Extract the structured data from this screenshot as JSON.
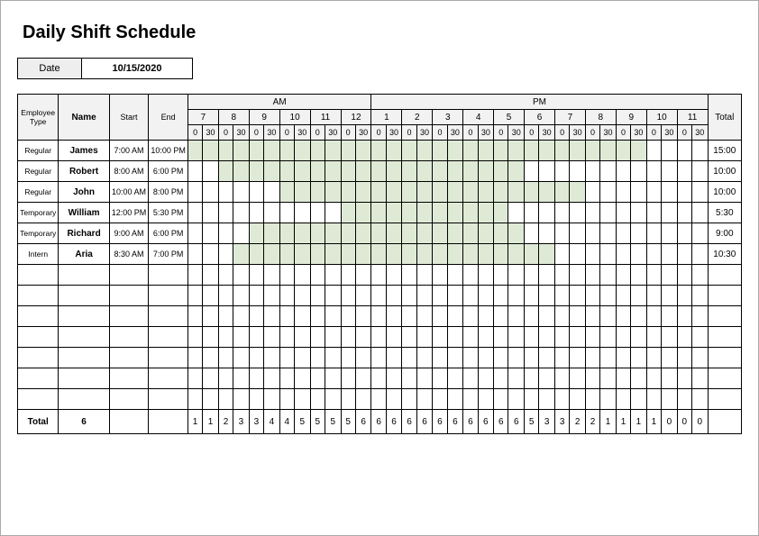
{
  "title": "Daily Shift Schedule",
  "date_label": "Date",
  "date_value": "10/15/2020",
  "headers": {
    "employee_type": "Employee\nType",
    "name": "Name",
    "start": "Start",
    "end": "End",
    "am": "AM",
    "pm": "PM",
    "total": "Total",
    "hours": [
      "7",
      "8",
      "9",
      "10",
      "11",
      "12",
      "1",
      "2",
      "3",
      "4",
      "5",
      "6",
      "7",
      "8",
      "9",
      "10",
      "11"
    ],
    "halves": [
      "0",
      "30"
    ]
  },
  "slot_start_hour": 7,
  "slot_count": 34,
  "rows": [
    {
      "type": "Regular",
      "name": "James",
      "start": "7:00 AM",
      "end": "10:00 PM",
      "fill_from": 0,
      "fill_to": 30,
      "total": "15:00"
    },
    {
      "type": "Regular",
      "name": "Robert",
      "start": "8:00 AM",
      "end": "6:00 PM",
      "fill_from": 2,
      "fill_to": 22,
      "total": "10:00"
    },
    {
      "type": "Regular",
      "name": "John",
      "start": "10:00 AM",
      "end": "8:00 PM",
      "fill_from": 6,
      "fill_to": 26,
      "total": "10:00"
    },
    {
      "type": "Temporary",
      "name": "William",
      "start": "12:00 PM",
      "end": "5:30 PM",
      "fill_from": 10,
      "fill_to": 21,
      "total": "5:30"
    },
    {
      "type": "Temporary",
      "name": "Richard",
      "start": "9:00 AM",
      "end": "6:00 PM",
      "fill_from": 4,
      "fill_to": 22,
      "total": "9:00"
    },
    {
      "type": "Intern",
      "name": "Aria",
      "start": "8:30 AM",
      "end": "7:00 PM",
      "fill_from": 3,
      "fill_to": 24,
      "total": "10:30"
    }
  ],
  "empty_rows": 7,
  "totals": {
    "label": "Total",
    "count": "6",
    "start": "",
    "end": "",
    "slots": [
      "1",
      "1",
      "2",
      "3",
      "3",
      "4",
      "4",
      "5",
      "5",
      "5",
      "5",
      "6",
      "6",
      "6",
      "6",
      "6",
      "6",
      "6",
      "6",
      "6",
      "6",
      "6",
      "5",
      "3",
      "3",
      "2",
      "2",
      "1",
      "1",
      "1",
      "1",
      "0",
      "0",
      "0"
    ],
    "grand_total": ""
  }
}
